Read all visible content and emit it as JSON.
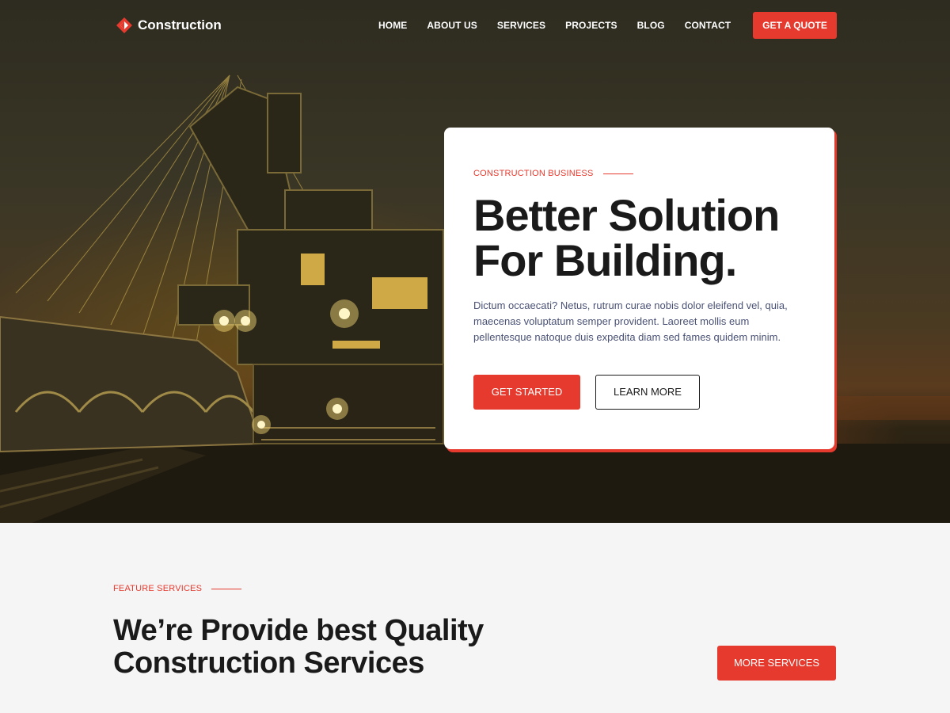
{
  "brand": {
    "name": "Construction",
    "accent": "#e63a2e"
  },
  "nav": {
    "items": [
      {
        "label": "HOME"
      },
      {
        "label": "ABOUT US"
      },
      {
        "label": "SERVICES"
      },
      {
        "label": "PROJECTS"
      },
      {
        "label": "BLOG"
      },
      {
        "label": "CONTACT"
      }
    ],
    "cta_label": "GET A QUOTE"
  },
  "hero": {
    "background": "night-mining-excavator-image",
    "eyebrow": "CONSTRUCTION BUSINESS",
    "headline_line1": "Better Solution",
    "headline_line2": "For Building.",
    "description": "Dictum occaecati? Netus, rutrum curae nobis dolor eleifend vel, quia, maecenas voluptatum semper provident. Laoreet mollis eum pellentesque natoque duis expedita diam sed fames quidem minim.",
    "primary_button": "GET STARTED",
    "secondary_button": "LEARN MORE"
  },
  "services": {
    "eyebrow": "FEATURE SERVICES",
    "title_line1": "We’re Provide best Quality",
    "title_line2": "Construction Services",
    "button": "MORE SERVICES"
  }
}
